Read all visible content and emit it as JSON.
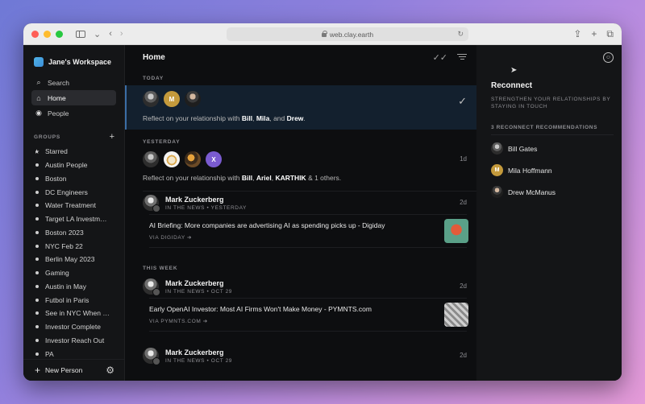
{
  "browser": {
    "url": "web.clay.earth"
  },
  "workspace": {
    "name": "Jane's Workspace"
  },
  "nav": [
    {
      "label": "Search",
      "icon": "search-icon"
    },
    {
      "label": "Home",
      "icon": "home-icon"
    },
    {
      "label": "People",
      "icon": "people-icon"
    }
  ],
  "groups_label": "GROUPS",
  "groups": [
    "Starred",
    "Austin People",
    "Boston",
    "DC Engineers",
    "Water Treatment",
    "Target LA Investm…",
    "Boston 2023",
    "NYC Feb 22",
    "Berlin May 2023",
    "Gaming",
    "Austin in May",
    "Futbol in Paris",
    "See in NYC When …",
    "Investor Complete",
    "Investor Reach Out",
    "PA"
  ],
  "footer": {
    "new_person": "New Person"
  },
  "main": {
    "title": "Home",
    "today": "TODAY",
    "yesterday": "YESTERDAY",
    "this_week": "THIS WEEK",
    "card1": {
      "prefix": "Reflect on your relationship with ",
      "n1": "Bill",
      "sep1": ", ",
      "n2": "Mila",
      "sep2": ", and ",
      "n3": "Drew",
      "end": "."
    },
    "card2": {
      "prefix": "Reflect on your relationship with ",
      "n1": "Bill",
      "sep1": ", ",
      "n2": "Ariel",
      "sep2": ", ",
      "n3": "KARTHIK",
      "end": " & 1 others.",
      "days": "1d",
      "x_initial": "X"
    },
    "news1": {
      "name": "Mark Zuckerberg",
      "sub": "IN THE NEWS • YESTERDAY",
      "days": "2d",
      "title": "AI Briefing: More companies are advertising AI as spending picks up - Digiday",
      "via": "VIA DIGIDAY ➔"
    },
    "news2": {
      "name": "Mark Zuckerberg",
      "sub": "IN THE NEWS • OCT 29",
      "days": "2d",
      "title": "Early OpenAI Investor: Most AI Firms Won't Make Money - PYMNTS.com",
      "via": "VIA PYMNTS.COM ➔"
    },
    "news3": {
      "name": "Mark Zuckerberg",
      "sub": "IN THE NEWS • OCT 29",
      "days": "2d"
    },
    "m_initial": "M"
  },
  "reconnect": {
    "title": "Reconnect",
    "subtitle": "STRENGTHEN YOUR RELATIONSHIPS BY STAYING IN TOUCH",
    "count": "3 RECONNECT RECOMMENDATIONS",
    "people": [
      {
        "name": "Bill Gates"
      },
      {
        "name": "Mila Hoffmann",
        "initial": "M"
      },
      {
        "name": "Drew McManus"
      }
    ]
  },
  "colors": {
    "accent": "#3b6ea5",
    "link": "#4a90e2",
    "mila": "#c49a3c",
    "x_avatar": "#7a5bd0"
  }
}
